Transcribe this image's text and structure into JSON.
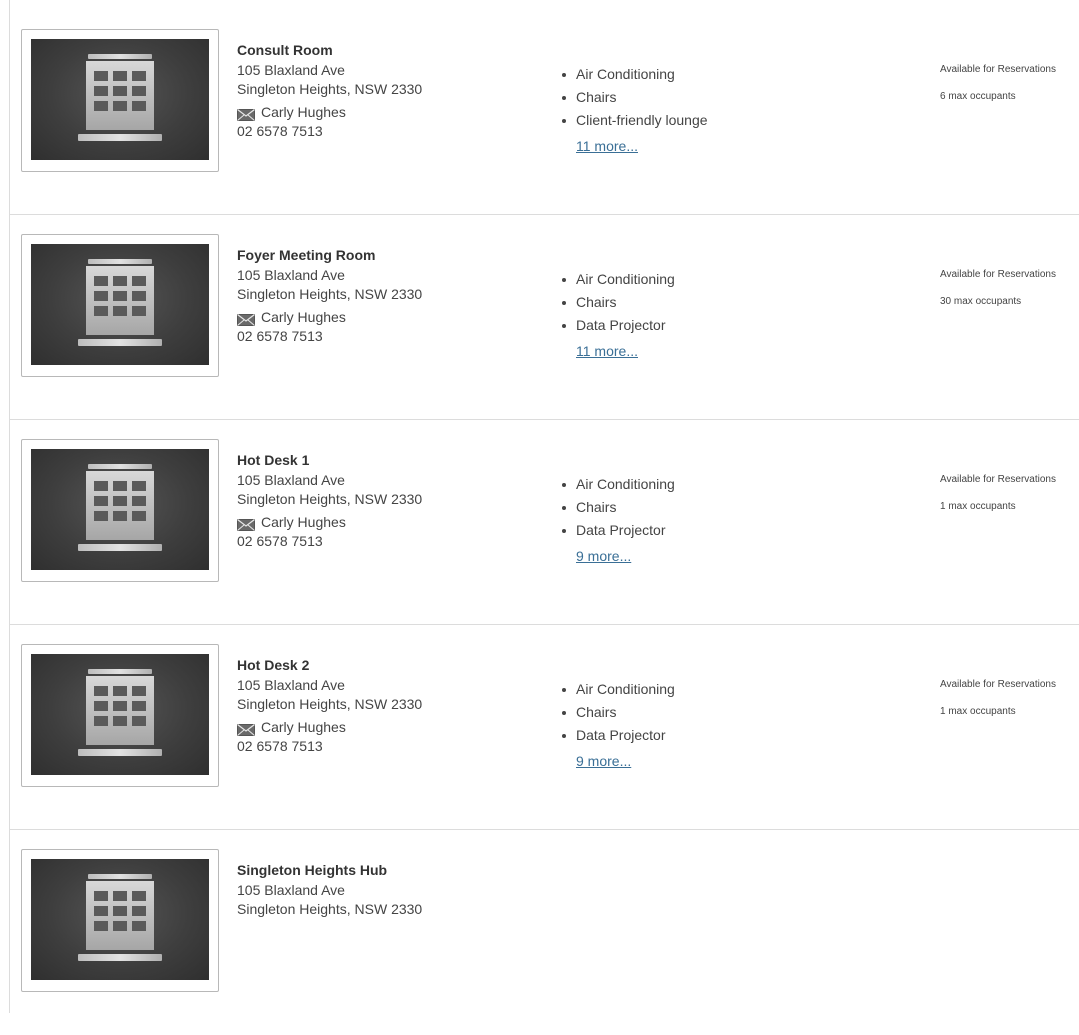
{
  "listings": [
    {
      "title": "Consult Room",
      "address_line1": "105 Blaxland Ave",
      "address_line2": "Singleton Heights, NSW 2330",
      "contact_name": "Carly Hughes",
      "phone": "02 6578 7513",
      "features": [
        "Air Conditioning",
        "Chairs",
        "Client-friendly lounge"
      ],
      "more_label": "11 more...",
      "availability": "Available for Reservations",
      "occupants": "6 max occupants"
    },
    {
      "title": "Foyer Meeting Room",
      "address_line1": "105 Blaxland Ave",
      "address_line2": "Singleton Heights, NSW 2330",
      "contact_name": "Carly Hughes",
      "phone": "02 6578 7513",
      "features": [
        "Air Conditioning",
        "Chairs",
        "Data Projector"
      ],
      "more_label": "11 more...",
      "availability": "Available for Reservations",
      "occupants": "30 max occupants"
    },
    {
      "title": "Hot Desk 1",
      "address_line1": "105 Blaxland Ave",
      "address_line2": "Singleton Heights, NSW 2330",
      "contact_name": "Carly Hughes",
      "phone": "02 6578 7513",
      "features": [
        "Air Conditioning",
        "Chairs",
        "Data Projector"
      ],
      "more_label": "9 more...",
      "availability": "Available for Reservations",
      "occupants": "1 max occupants"
    },
    {
      "title": "Hot Desk 2",
      "address_line1": "105 Blaxland Ave",
      "address_line2": "Singleton Heights, NSW 2330",
      "contact_name": "Carly Hughes",
      "phone": "02 6578 7513",
      "features": [
        "Air Conditioning",
        "Chairs",
        "Data Projector"
      ],
      "more_label": "9 more...",
      "availability": "Available for Reservations",
      "occupants": "1 max occupants"
    },
    {
      "title": "Singleton Heights Hub",
      "address_line1": "105 Blaxland Ave",
      "address_line2": "Singleton Heights, NSW 2330"
    }
  ],
  "icons": {
    "thumbnail": "building-icon",
    "contact": "mail-icon"
  },
  "colors": {
    "link": "#3a6f96",
    "divider": "#dcdcdc",
    "thumbnail_bg": "#3e3e3e"
  }
}
